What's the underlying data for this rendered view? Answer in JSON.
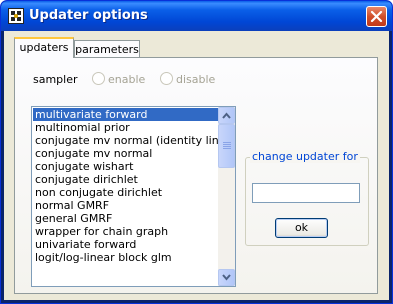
{
  "window": {
    "title": "Updater options"
  },
  "tabs": [
    {
      "label": "updaters",
      "active": true
    },
    {
      "label": "parameters",
      "active": false
    }
  ],
  "sampler": {
    "label": "sampler",
    "enable_label": "enable",
    "disable_label": "disable"
  },
  "updater_list": {
    "selected": "multivariate forward",
    "items": [
      "multivariate forward",
      "multinomial prior",
      "conjugate mv normal (identity link)",
      "conjugate mv normal",
      "conjugate wishart",
      "conjugate dirichlet",
      "non conjugate dirichlet",
      "normal GMRF",
      "general GMRF",
      "wrapper for chain graph",
      "univariate forward",
      "logit/log-linear block glm"
    ]
  },
  "change_updater": {
    "label": "change updater for",
    "value": "",
    "ok_label": "ok"
  },
  "colors": {
    "titlebar": "#0a5fe8",
    "selection": "#316ac5",
    "group_label": "#0046d5",
    "client": "#ece9d8"
  }
}
